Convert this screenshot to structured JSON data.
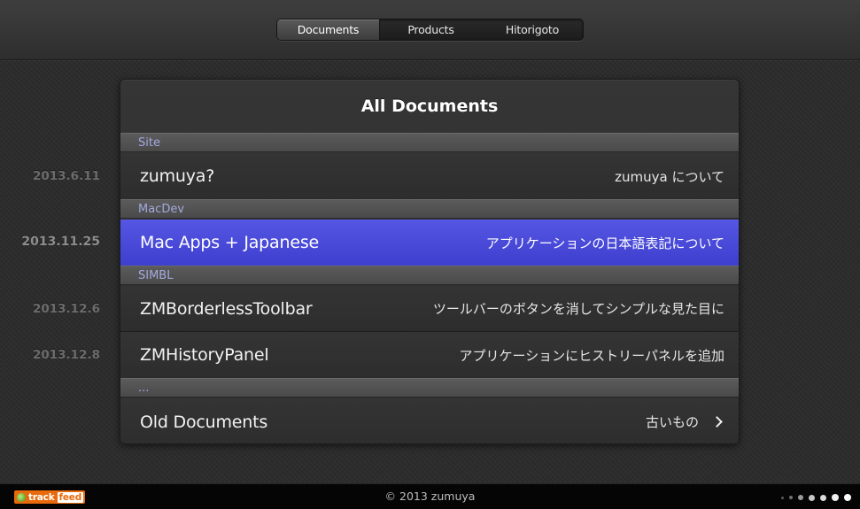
{
  "nav": {
    "tabs": [
      {
        "label": "Documents",
        "active": true
      },
      {
        "label": "Products",
        "active": false
      },
      {
        "label": "Hitorigoto",
        "active": false
      }
    ]
  },
  "panel": {
    "title": "All Documents",
    "sections": [
      {
        "name": "Site",
        "rows": [
          {
            "date": "2013.6.11",
            "title": "zumuya?",
            "subtitle": "zumuya について"
          }
        ]
      },
      {
        "name": "MacDev",
        "rows": [
          {
            "date": "2013.11.25",
            "title": "Mac Apps + Japanese",
            "subtitle": "アプリケーションの日本語表記について",
            "highlighted": true
          }
        ]
      },
      {
        "name": "SIMBL",
        "rows": [
          {
            "date": "2013.12.6",
            "title": "ZMBorderlessToolbar",
            "subtitle": "ツールバーのボタンを消してシンプルな見た目に"
          },
          {
            "date": "2013.12.8",
            "title": "ZMHistoryPanel",
            "subtitle": "アプリケーションにヒストリーパネルを追加"
          }
        ]
      },
      {
        "name": "...",
        "rows": [
          {
            "title": "Old Documents",
            "subtitle": "古いもの",
            "icon": "chevron-right-icon"
          }
        ]
      }
    ]
  },
  "footer": {
    "copyright": "© 2013 zumuya",
    "badge": {
      "part1": "track",
      "part2": "feed"
    }
  },
  "colors": {
    "highlight": "#4a4ad8",
    "section_text": "#a3a9dd",
    "badge": "#e86a0c"
  }
}
